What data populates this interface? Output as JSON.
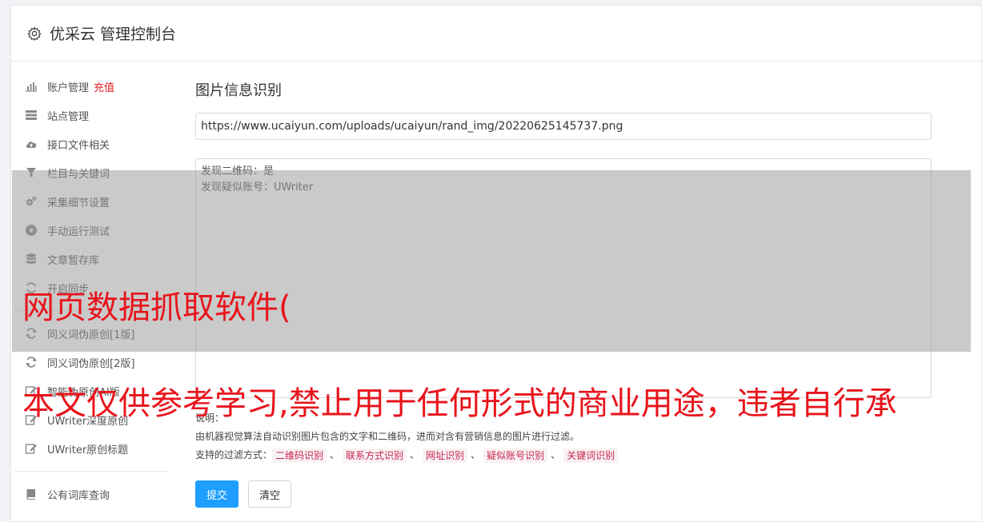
{
  "header": {
    "title": "优采云 管理控制台",
    "icon": "gear-icon"
  },
  "sidebar": {
    "items": [
      {
        "label": "账户管理",
        "accent": "充值",
        "icon": "bar-chart-icon"
      },
      {
        "label": "站点管理",
        "icon": "server-icon"
      },
      {
        "label": "接口文件相关",
        "icon": "cloud-upload-icon"
      },
      {
        "label": "栏目与关键词",
        "icon": "filter-icon"
      },
      {
        "label": "采集细节设置",
        "icon": "cogs-icon"
      },
      {
        "label": "手动运行测试",
        "icon": "play-circle-icon"
      },
      {
        "label": "文章暂存库",
        "icon": "database-icon"
      },
      {
        "label": "开启同步",
        "icon": "sync-icon"
      },
      {
        "label": "同义词伪原创[1版]",
        "icon": "refresh-icon"
      },
      {
        "label": "同义词伪原创[2版]",
        "icon": "refresh-icon"
      },
      {
        "label": "智能伪原创AI版",
        "icon": "edit-icon"
      },
      {
        "label": "UWriter深度原创",
        "icon": "edit-icon"
      },
      {
        "label": "UWriter原创标题",
        "icon": "edit-icon"
      },
      {
        "label": "公有词库查询",
        "icon": "book-icon"
      }
    ]
  },
  "main": {
    "title": "图片信息识别",
    "url_value": "https://www.ucaiyun.com/uploads/ucaiyun/rand_img/20220625145737.png",
    "result_lines": [
      "发现二维码：是",
      "发现疑似账号：UWriter"
    ],
    "notes_label": "说明：",
    "notes_desc": "由机器视觉算法自动识别图片包含的文字和二维码，进而对含有营销信息的图片进行过滤。",
    "filter_label": "支持的过滤方式：",
    "filter_tags": [
      "二维码识别",
      "联系方式识别",
      "网址识别",
      "疑似账号识别",
      "关键词识别"
    ],
    "filter_sep": "、",
    "submit_label": "提交",
    "clear_label": "清空"
  },
  "watermark": {
    "line1": "网页数据抓取软件(",
    "line2": "本文仅供参考学习,禁止用于任何形式的商业用途，违者自行承"
  },
  "colors": {
    "primary": "#1e9fff",
    "accent": "#e02020",
    "tag_text": "#c7254e",
    "watermark": "#e8141b"
  }
}
